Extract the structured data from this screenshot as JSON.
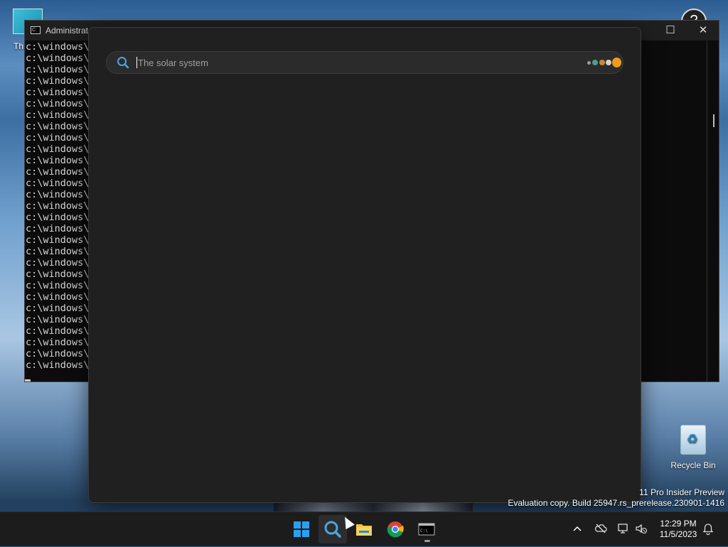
{
  "desktop": {
    "top_icon_label": "Th",
    "recycle_bin_label": "Recycle Bin",
    "watermark_line1": "11 Pro Insider Preview",
    "watermark_line2": "Evaluation copy. Build 25947.rs_prerelease.230901-1416"
  },
  "console": {
    "title": "Administrat",
    "lines": [
      "c:\\windows\\s",
      "c:\\windows\\s",
      "c:\\windows\\s",
      "c:\\windows\\s",
      "c:\\windows\\s",
      "c:\\windows\\s",
      "c:\\windows\\s",
      "c:\\windows\\s",
      "c:\\windows\\s",
      "c:\\windows\\s",
      "c:\\windows\\s",
      "c:\\windows\\s",
      "c:\\windows\\s",
      "c:\\windows\\s",
      "c:\\windows\\s",
      "c:\\windows\\s",
      "c:\\windows\\s",
      "c:\\windows\\s",
      "c:\\windows\\s",
      "c:\\windows\\s",
      "c:\\windows\\s",
      "c:\\windows\\s",
      "c:\\windows\\s",
      "c:\\windows\\s",
      "c:\\windows\\s",
      "c:\\windows\\s",
      "c:\\windows\\s",
      "c:\\windows\\s",
      "c:\\windows\\s"
    ]
  },
  "search": {
    "placeholder": "The solar system",
    "value": ""
  },
  "taskbar": {
    "apps": [
      "start-icon",
      "search-icon",
      "file-explorer-icon",
      "chrome-icon",
      "terminal-icon"
    ],
    "clock_time": "12:29 PM",
    "clock_date": "11/5/2023"
  }
}
